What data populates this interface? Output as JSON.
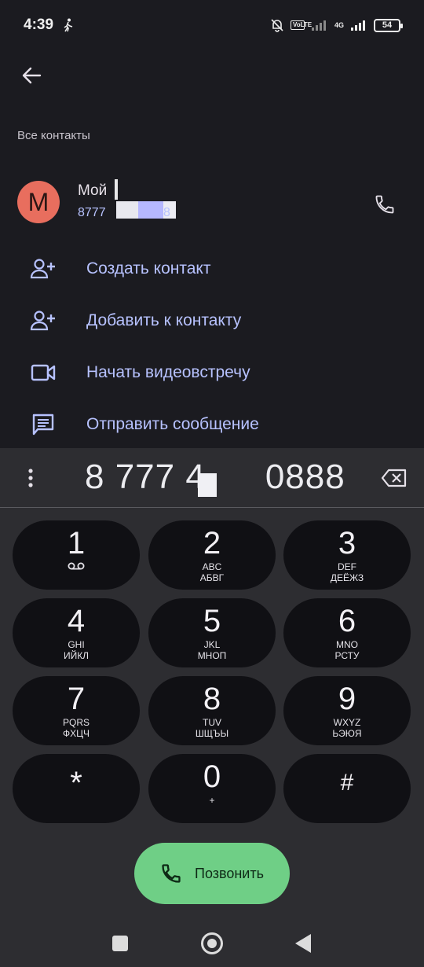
{
  "status": {
    "time": "4:39",
    "network_badge": "VoLTE",
    "network_type": "4G",
    "battery": "54"
  },
  "section_label": "Все контакты",
  "contact": {
    "avatar_letter": "М",
    "name": "Мой",
    "number": "8777",
    "number_tail": "8"
  },
  "actions": [
    {
      "label": "Создать контакт",
      "icon": "add-person-icon"
    },
    {
      "label": "Добавить к контакту",
      "icon": "add-person-icon"
    },
    {
      "label": "Начать видеовстречу",
      "icon": "video-camera-icon"
    },
    {
      "label": "Отправить сообщение",
      "icon": "message-icon"
    }
  ],
  "dialer": {
    "number_left": "8 777 4",
    "number_right": "0888",
    "keys": [
      {
        "digit": "1",
        "sub": ""
      },
      {
        "digit": "2",
        "sub": "ABC",
        "sub2": "АБВГ"
      },
      {
        "digit": "3",
        "sub": "DEF",
        "sub2": "ДЕЁЖЗ"
      },
      {
        "digit": "4",
        "sub": "GHI",
        "sub2": "ИЙКЛ"
      },
      {
        "digit": "5",
        "sub": "JKL",
        "sub2": "МНОП"
      },
      {
        "digit": "6",
        "sub": "MNO",
        "sub2": "РСТУ"
      },
      {
        "digit": "7",
        "sub": "PQRS",
        "sub2": "ФХЦЧ"
      },
      {
        "digit": "8",
        "sub": "TUV",
        "sub2": "ШЩЪЫ"
      },
      {
        "digit": "9",
        "sub": "WXYZ",
        "sub2": "ЬЭЮЯ"
      },
      {
        "digit": "*",
        "sub": ""
      },
      {
        "digit": "0",
        "sub": "+"
      },
      {
        "digit": "#",
        "sub": ""
      }
    ],
    "call_label": "Позвонить"
  },
  "colors": {
    "background": "#1b1b20",
    "accent": "#b7c2ff",
    "avatar": "#e86e5e",
    "call_button": "#6fcf86"
  }
}
